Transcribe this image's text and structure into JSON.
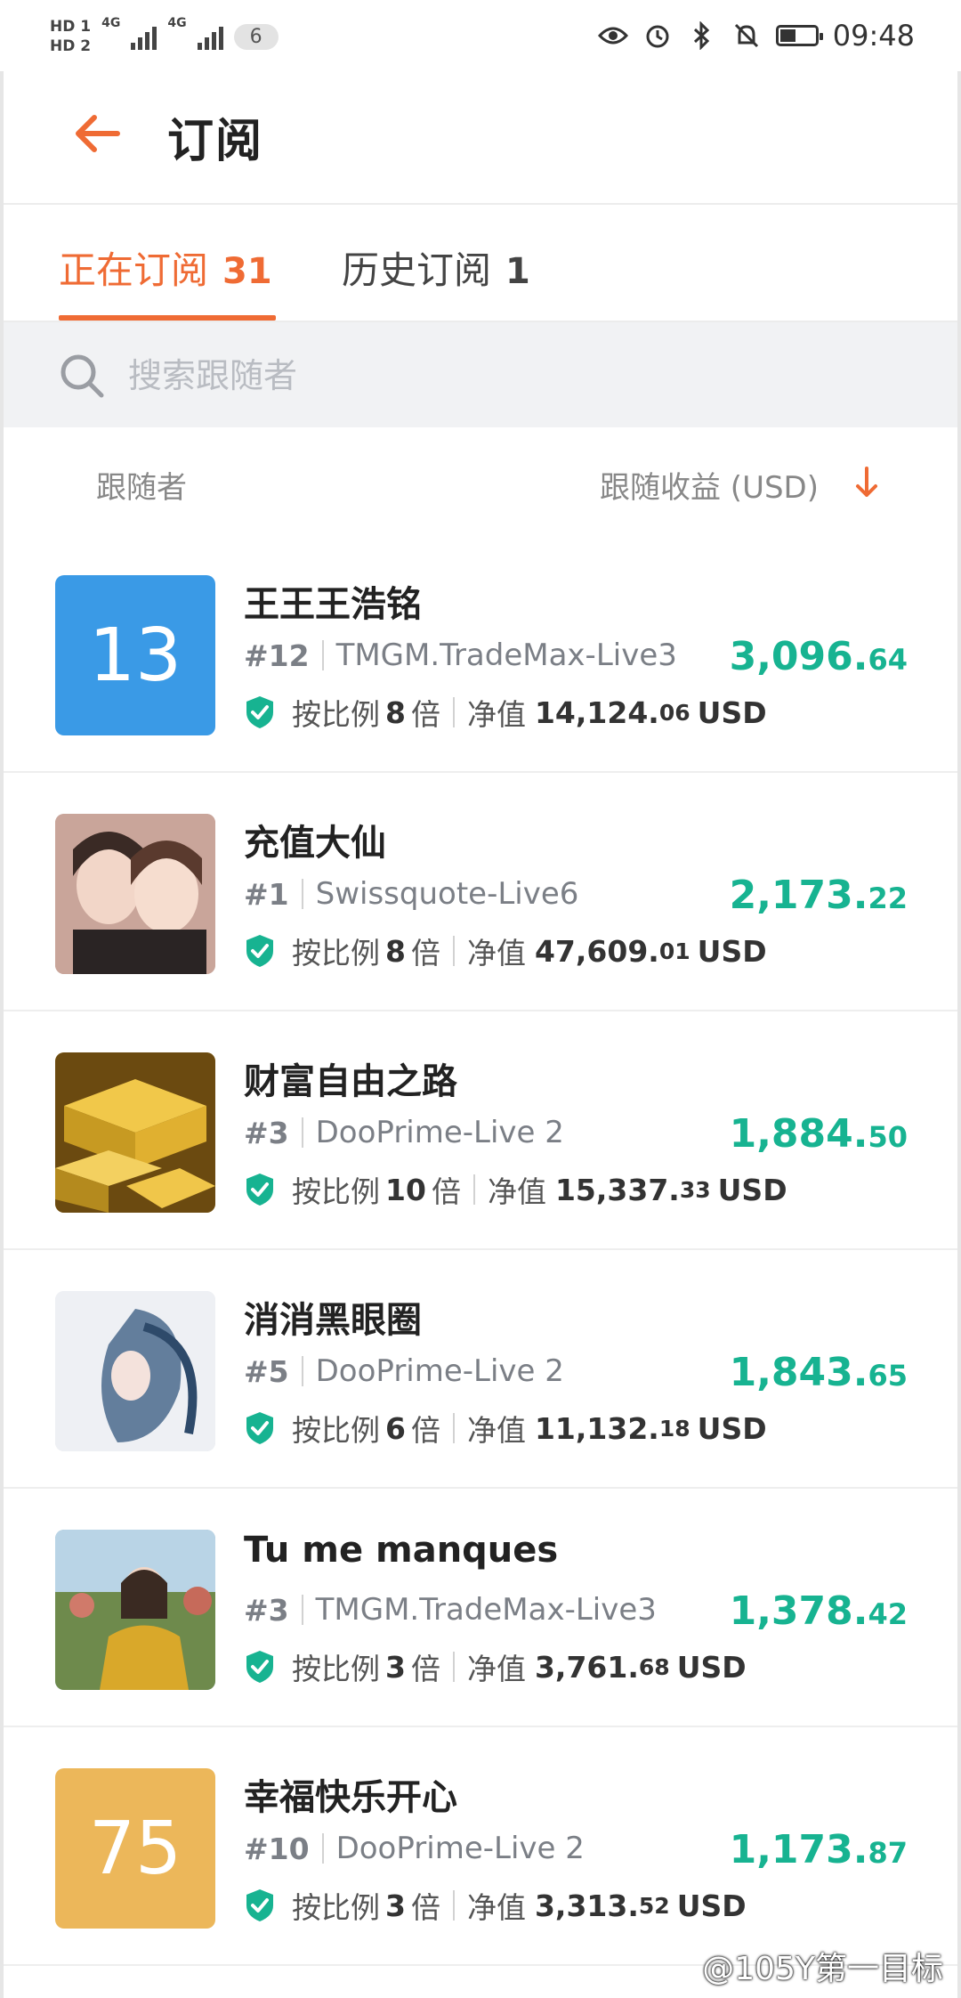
{
  "status_bar": {
    "hd1": "HD 1",
    "hd2": "HD 2",
    "net1": "4G",
    "net2": "4G",
    "sim_badge": "6",
    "time": "09:48",
    "battery_level": 0.45
  },
  "header": {
    "title": "订阅",
    "back_icon": "arrow-left-icon"
  },
  "tabs": [
    {
      "label": "正在订阅",
      "count": "31",
      "active": true
    },
    {
      "label": "历史订阅",
      "count": "1",
      "active": false
    }
  ],
  "search": {
    "placeholder": "搜索跟随者"
  },
  "columns": {
    "left": "跟随者",
    "right": "跟随收益 (USD)"
  },
  "followers": [
    {
      "name": "王王王浩铭",
      "rank": "#12",
      "server": "TMGM.TradeMax-Live3",
      "ratio_label": "按比例",
      "ratio": "8",
      "ratio_unit": "倍",
      "net_label": "净值",
      "net_int": "14,124.",
      "net_dec": "06",
      "currency": "USD",
      "profit_int": "3,096.",
      "profit_dec": "64",
      "avatar_text": "13",
      "avatar_color": "#3a9ae6"
    },
    {
      "name": "充值大仙",
      "rank": "#1",
      "server": "Swissquote-Live6",
      "ratio_label": "按比例",
      "ratio": "8",
      "ratio_unit": "倍",
      "net_label": "净值",
      "net_int": "47,609.",
      "net_dec": "01",
      "currency": "USD",
      "profit_int": "2,173.",
      "profit_dec": "22",
      "avatar_text": "",
      "avatar_color": "#c9a59a"
    },
    {
      "name": "财富自由之路",
      "rank": "#3",
      "server": "DooPrime-Live 2",
      "ratio_label": "按比例",
      "ratio": "10",
      "ratio_unit": "倍",
      "net_label": "净值",
      "net_int": "15,337.",
      "net_dec": "33",
      "currency": "USD",
      "profit_int": "1,884.",
      "profit_dec": "50",
      "avatar_text": "",
      "avatar_color": "#c9961f"
    },
    {
      "name": "消消黑眼圈",
      "rank": "#5",
      "server": "DooPrime-Live 2",
      "ratio_label": "按比例",
      "ratio": "6",
      "ratio_unit": "倍",
      "net_label": "净值",
      "net_int": "11,132.",
      "net_dec": "18",
      "currency": "USD",
      "profit_int": "1,843.",
      "profit_dec": "65",
      "avatar_text": "",
      "avatar_color": "#dfe3ea"
    },
    {
      "name": "Tu me manques",
      "rank": "#3",
      "server": "TMGM.TradeMax-Live3",
      "ratio_label": "按比例",
      "ratio": "3",
      "ratio_unit": "倍",
      "net_label": "净值",
      "net_int": "3,761.",
      "net_dec": "68",
      "currency": "USD",
      "profit_int": "1,378.",
      "profit_dec": "42",
      "avatar_text": "",
      "avatar_color": "#8fb3c7"
    },
    {
      "name": "幸福快乐开心",
      "rank": "#10",
      "server": "DooPrime-Live 2",
      "ratio_label": "按比例",
      "ratio": "3",
      "ratio_unit": "倍",
      "net_label": "净值",
      "net_int": "3,313.",
      "net_dec": "52",
      "currency": "USD",
      "profit_int": "1,173.",
      "profit_dec": "87",
      "avatar_text": "75",
      "avatar_color": "#ecb75a"
    }
  ],
  "watermark": "@105Y第一目标",
  "colors": {
    "accent": "#ef6b34",
    "profit": "#17b391",
    "shield": "#17b391"
  }
}
